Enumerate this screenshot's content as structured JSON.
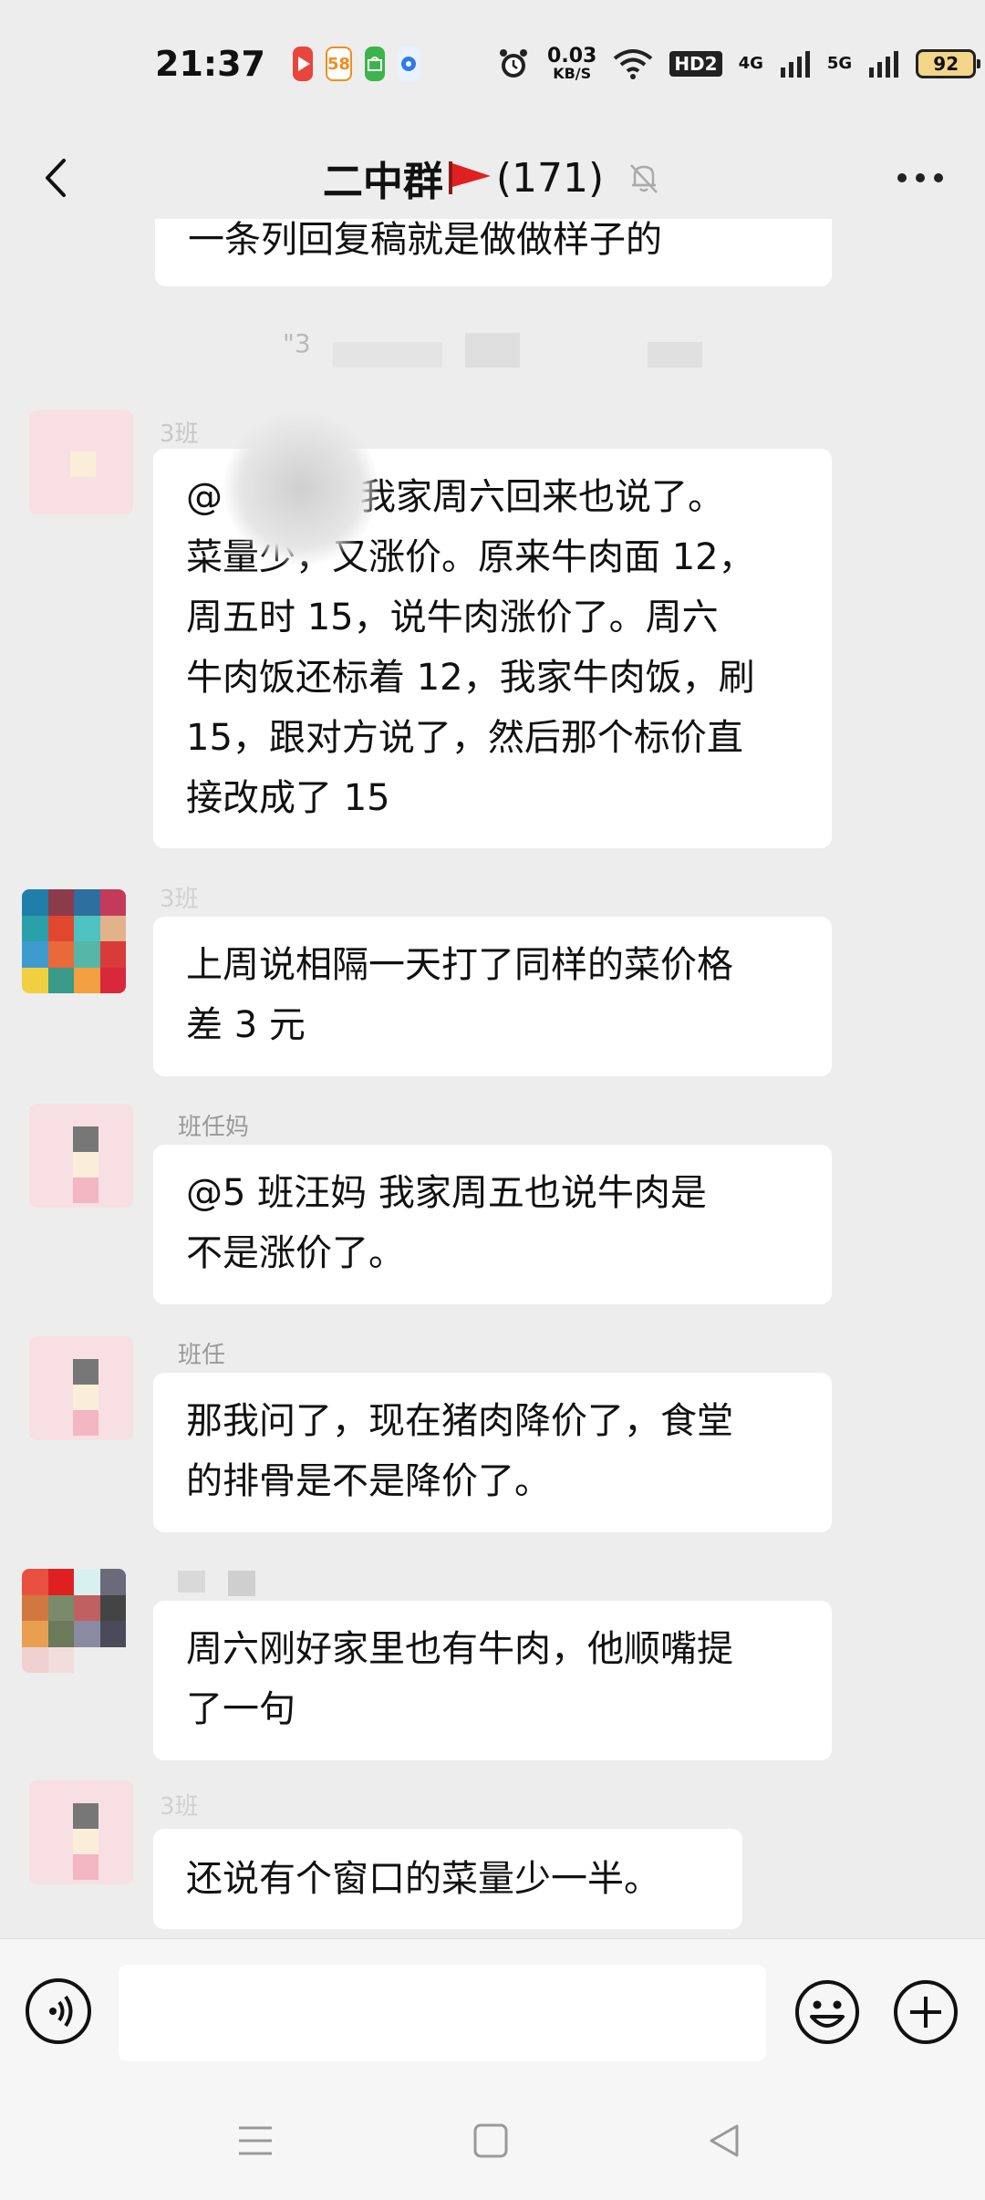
{
  "status_bar": {
    "time": "21:37",
    "network_speed_value": "0.03",
    "network_speed_unit": "KB/S",
    "hd_label": "HD2",
    "net_4g": "4G",
    "net_5g": "5G",
    "battery": "92",
    "app_icon_58": "58"
  },
  "header": {
    "title": "二中群",
    "member_count": "(171)"
  },
  "system_message": "\"3",
  "messages": [
    {
      "text": "一条列回复稿就是做做样子的"
    },
    {
      "sender": "3班",
      "text_lines": [
        "@",
        "我家周六回来也说了。",
        "菜量少，又涨价。原来牛肉面 12，",
        "周五时 15，说牛肉涨价了。周六",
        "牛肉饭还标着 12，我家牛肉饭，刷",
        "15，跟对方说了，然后那个标价直",
        "接改成了 15"
      ]
    },
    {
      "sender": "3班",
      "text_lines": [
        "上周说相隔一天打了同样的菜价格",
        "差 3 元"
      ]
    },
    {
      "sender": "班任妈",
      "text_lines": [
        "@5 班汪妈  我家周五也说牛肉是",
        "不是涨价了。"
      ]
    },
    {
      "sender": "班任",
      "text_lines": [
        "那我问了，现在猪肉降价了，食堂",
        "的排骨是不是降价了。"
      ]
    },
    {
      "sender": "",
      "text_lines": [
        "周六刚好家里也有牛肉，他顺嘴提",
        "了一句"
      ]
    },
    {
      "sender": "3班",
      "text_lines": [
        "还说有个窗口的菜量少一半。"
      ]
    }
  ],
  "input": {
    "placeholder": ""
  },
  "colors": {
    "background": "#ededed",
    "bubble": "#ffffff",
    "sender": "#999999"
  }
}
